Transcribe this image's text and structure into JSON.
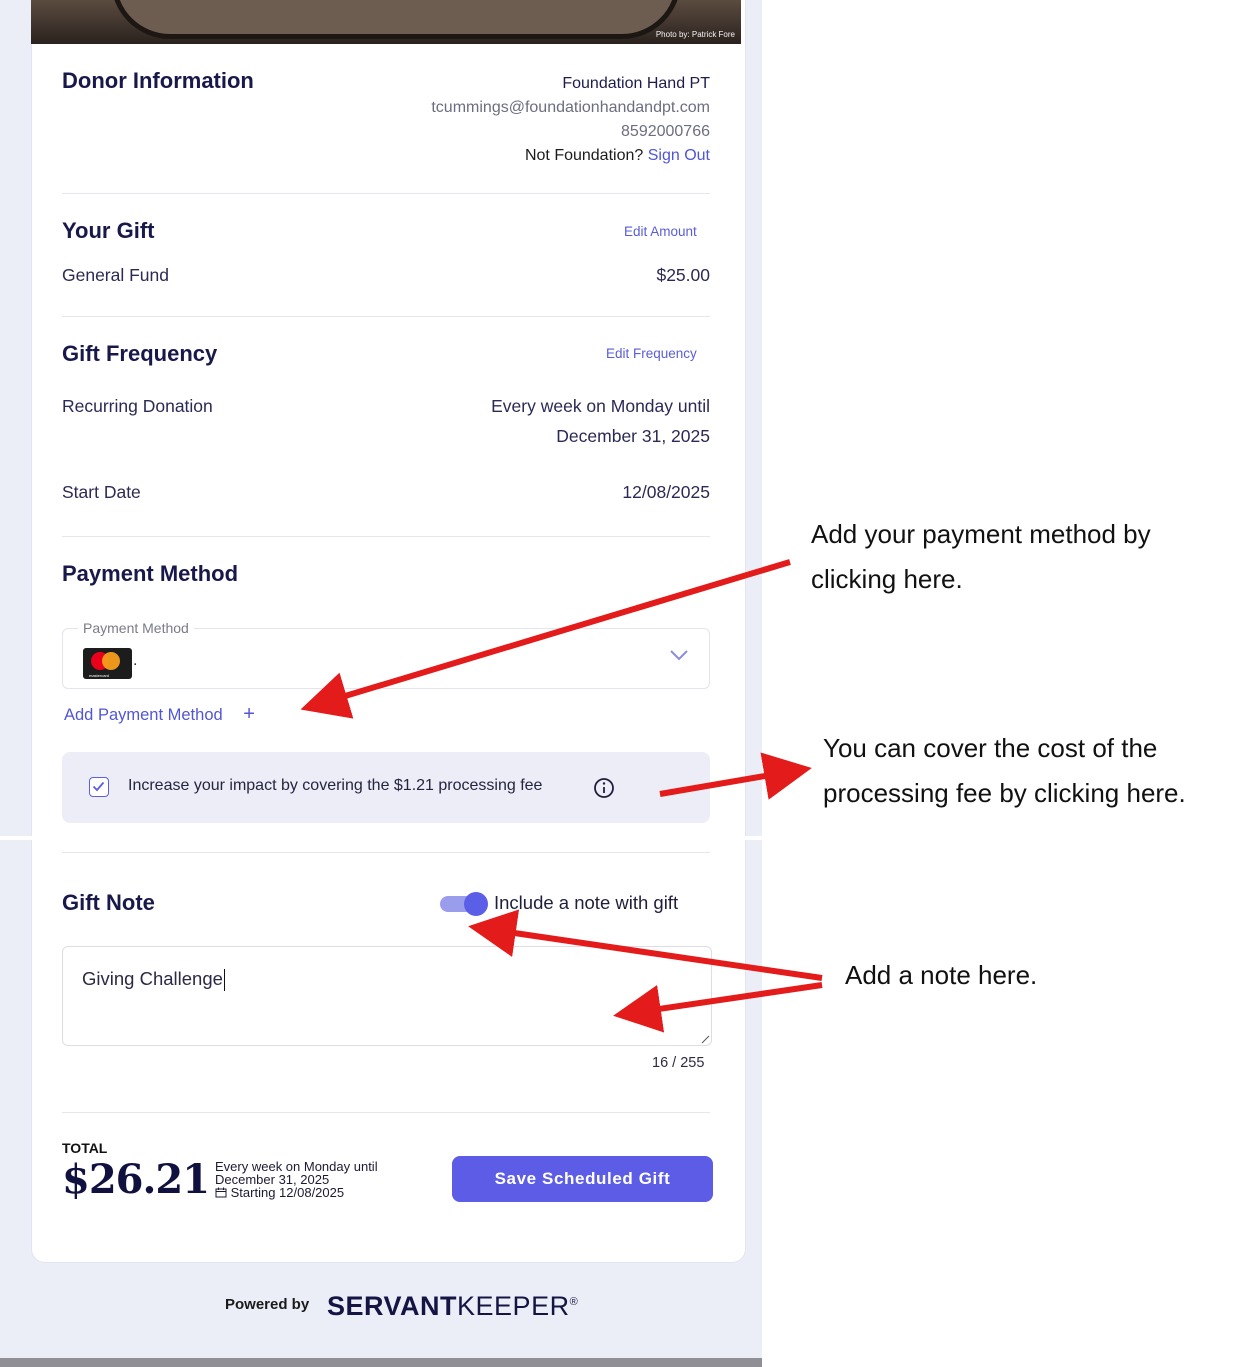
{
  "photo": {
    "credit": "Photo by: Patrick Fore"
  },
  "donor": {
    "title": "Donor Information",
    "name": "Foundation Hand PT",
    "email": "tcummings@foundationhandandpt.com",
    "phone": "8592000766",
    "not_user": "Not Foundation?",
    "sign_out": "Sign Out"
  },
  "gift": {
    "title": "Your Gift",
    "edit_label": "Edit Amount",
    "fund": "General Fund",
    "amount": "$25.00"
  },
  "frequency": {
    "title": "Gift Frequency",
    "edit_label": "Edit Frequency",
    "recurring_label": "Recurring Donation",
    "recurring_value_line1": "Every week on Monday until",
    "recurring_value_line2": "December 31, 2025",
    "start_label": "Start Date",
    "start_value": "12/08/2025"
  },
  "payment": {
    "title": "Payment Method",
    "field_label": "Payment Method",
    "selected_value": ".",
    "card_icon": "mastercard-icon",
    "card_brand_text": "mastercard",
    "add_label": "Add Payment Method",
    "add_symbol": "+",
    "fee_text": "Increase your impact by covering the $1.21 processing fee",
    "fee_checked": true
  },
  "note": {
    "title": "Gift Note",
    "toggle_label": "Include a note with gift",
    "toggle_on": true,
    "value": "Giving Challenge",
    "counter": "16 / 255"
  },
  "total": {
    "label": "TOTAL",
    "amount": "$26.21",
    "schedule_line1": "Every week on Monday until",
    "schedule_line2": "December 31, 2025",
    "schedule_line3": "Starting 12/08/2025",
    "save_label": "Save Scheduled Gift"
  },
  "footer": {
    "powered_by": "Powered by",
    "brand_bold": "SERVANT",
    "brand_light": "KEEPER",
    "brand_mark": "®"
  },
  "annotations": {
    "payment_line1": "Add your payment method by",
    "payment_line2": "clicking here.",
    "fee_line1": "You can cover the cost of the",
    "fee_line2": "processing fee by clicking here.",
    "note": "Add a note here."
  },
  "colors": {
    "accent": "#5c5ce6",
    "arrow": "#e31b1b",
    "heading": "#18184a"
  }
}
